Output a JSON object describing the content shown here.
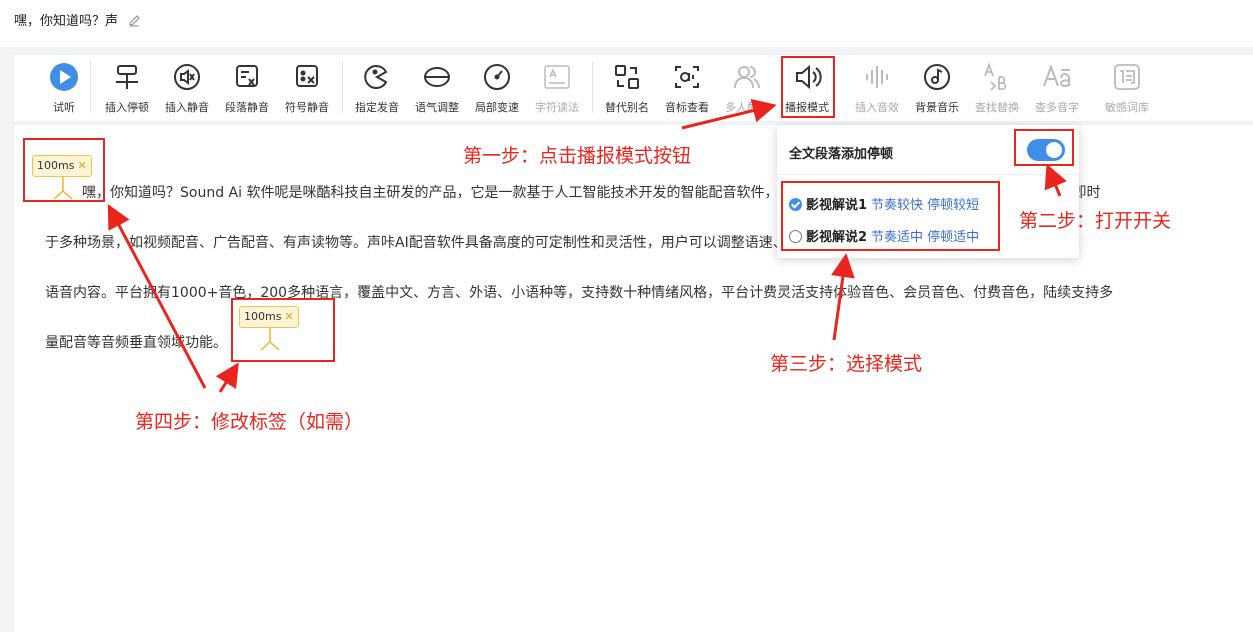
{
  "doc": {
    "title": "嘿，你知道吗？声"
  },
  "toolbar": {
    "items": [
      {
        "label": "试听",
        "icon": "play-icon",
        "disabled": false
      },
      {
        "label": "插入停顿",
        "icon": "pause-insert-icon",
        "disabled": false
      },
      {
        "label": "插入静音",
        "icon": "mute-insert-icon",
        "disabled": false
      },
      {
        "label": "段落静音",
        "icon": "paragraph-mute-icon",
        "disabled": false
      },
      {
        "label": "符号静音",
        "icon": "symbol-mute-icon",
        "disabled": false
      },
      {
        "label": "指定发音",
        "icon": "pronunciation-icon",
        "disabled": false
      },
      {
        "label": "语气调整",
        "icon": "tone-icon",
        "disabled": false
      },
      {
        "label": "局部变速",
        "icon": "speed-icon",
        "disabled": false
      },
      {
        "label": "字符读法",
        "icon": "char-reading-icon",
        "disabled": true
      },
      {
        "label": "替代别名",
        "icon": "alias-icon",
        "disabled": false
      },
      {
        "label": "音标查看",
        "icon": "phonetic-icon",
        "disabled": false
      },
      {
        "label": "多人配音",
        "icon": "multi-voice-icon",
        "disabled": true
      },
      {
        "label": "播报模式",
        "icon": "speaker-icon",
        "disabled": false
      },
      {
        "label": "插入音效",
        "icon": "sound-effect-icon",
        "disabled": true
      },
      {
        "label": "背景音乐",
        "icon": "music-icon",
        "disabled": false
      },
      {
        "label": "查找替换",
        "icon": "find-replace-icon",
        "disabled": true
      },
      {
        "label": "查多音字",
        "icon": "polyphone-icon",
        "disabled": true
      },
      {
        "label": "敏感词库",
        "icon": "sensitive-words-icon",
        "disabled": true
      }
    ]
  },
  "editor": {
    "lines": [
      "嘿，你知道吗？Sound Ai 软件呢是咪酷科技自主研发的产品，它是一款基于人工智能技术开发的智能配音软件，它利用先进的语音合成技术，实现文字转语音的即时",
      "于多种场景，如视频配音、广告配音、有声读物等。声咔AI配音软件具备高度的可定制性和灵活性，用户可以调整语速、语调、停顿、音量等自定义功能，轻松生成",
      "语音内容。平台拥有1000+音色，200多种语言，覆盖中文、方言、外语、小语种等，支持数十种情绪风格，平台计费灵活支持体验音色、会员音色、付费音色，陆续支持多",
      "量配音等音频垂直领域功能。"
    ],
    "pause_tags": [
      {
        "label": "100ms"
      },
      {
        "label": "100ms"
      }
    ]
  },
  "popup": {
    "title": "全文段落添加停顿",
    "toggle_on": true,
    "options": [
      {
        "name": "影视解说1",
        "desc": "节奏较快 停顿较短",
        "selected": true
      },
      {
        "name": "影视解说2",
        "desc": "节奏适中 停顿适中",
        "selected": false
      }
    ]
  },
  "annotations": {
    "step1": "第一步：点击播报模式按钮",
    "step2": "第二步：打开开关",
    "step3": "第三步：选择模式",
    "step4": "第四步：修改标签（如需）"
  },
  "colors": {
    "accent": "#3f8fe8",
    "annotation": "#e8261e",
    "tag_bg": "#fff4d6",
    "tag_border": "#f2c250"
  }
}
